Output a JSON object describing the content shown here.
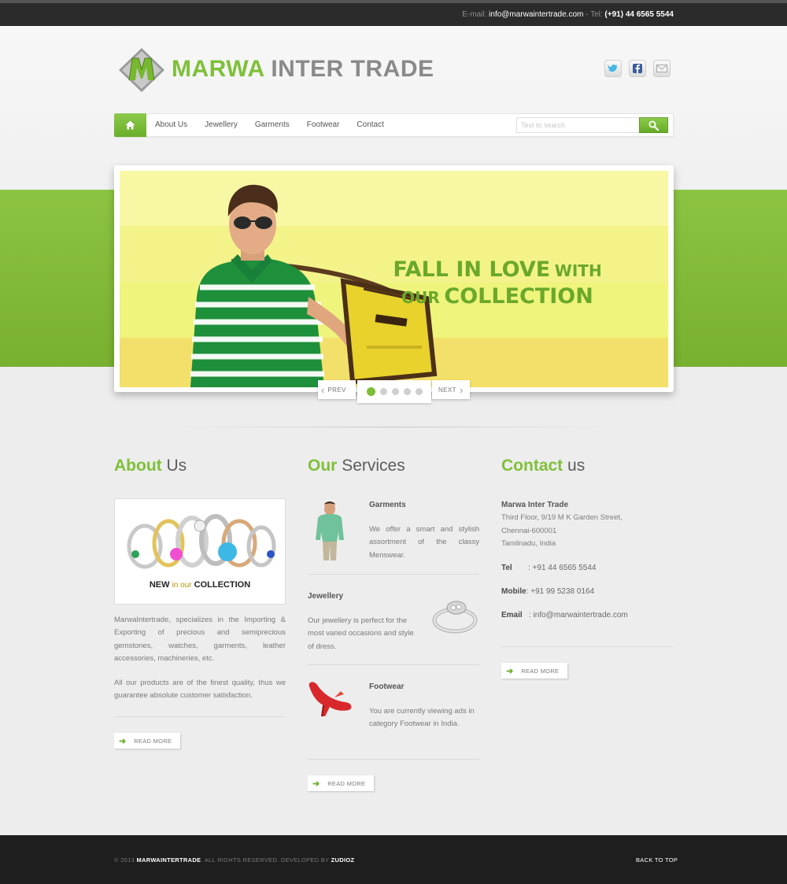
{
  "topbar": {
    "email_label": "E-mail:",
    "email": "info@marwaintertrade.com",
    "tel_label": "- Tel:",
    "tel": "(+91) 44 6565 5544"
  },
  "logo": {
    "word1": "MARWA",
    "word2": "INTER TRADE"
  },
  "social": [
    "twitter-icon",
    "facebook-icon",
    "mail-icon"
  ],
  "nav": {
    "home_icon": "home-icon",
    "items": [
      "About Us",
      "Jewellery",
      "Garments",
      "Footwear",
      "Contact"
    ],
    "search_placeholder": "Text to search",
    "search_icon": "search-icon"
  },
  "slider": {
    "line1a": "FALL IN LOVE",
    "line1b": "WITH",
    "line2a": "OUR",
    "line2b": "COLLECTION",
    "prev": "PREV",
    "next": "NEXT",
    "slide_count": 5,
    "active_slide": 1
  },
  "about": {
    "title_hl": "About",
    "title_rest": "Us",
    "image_caption_1": "NEW",
    "image_caption_2": "in our",
    "image_caption_3": "COLLECTION",
    "para1": "MarwaIntertrade, specializes in the Importing & Exporting of precious and semiprecious gemstones, watches, garments, leather accessories, machineries, etc.",
    "para2": "All our products are of the finest quality, thus we guarantee absolute customer satisfaction.",
    "read_more": "READ MORE"
  },
  "services": {
    "title_hl": "Our",
    "title_rest": "Services",
    "items": [
      {
        "heading": "Garments",
        "text": "We offer a smart and stylish assortment of the classy Menswear."
      },
      {
        "heading": "Jewellery",
        "text": "Our jewellery is perfect for the most varied occasions and style of dress."
      },
      {
        "heading": "Footwear",
        "text": "You are currently viewing ads in category Footwear in India."
      }
    ],
    "read_more": "READ MORE"
  },
  "contact": {
    "title_hl": "Contact",
    "title_rest": "us",
    "company": "Marwa Inter Trade",
    "address1": "Third Floor, 9/19 M K Garden Street,",
    "address2": "Chennai-600001",
    "address3": "Tamilnadu, India",
    "tel_label": "Tel",
    "tel": ": +91 44 6565 5544",
    "mobile_label": "Mobile",
    "mobile": ": +91 99 5238 0164",
    "email_label": "Email",
    "email": ": info@marwaintertrade.com",
    "read_more": "READ MORE"
  },
  "footer": {
    "copy_prefix": "© 2013",
    "brand": "MARWAINTERTRADE",
    "copy_mid": ". ALL RIGHTS RESERVED. DEVELOPED BY",
    "dev": "ZUDIOZ",
    "back_to_top": "BACK TO TOP"
  },
  "colors": {
    "brand_green": "#7fc03a",
    "dark_bar": "#2b2b2b",
    "footer": "#1e1e1e",
    "slide_yellow": "#f7f37a"
  }
}
